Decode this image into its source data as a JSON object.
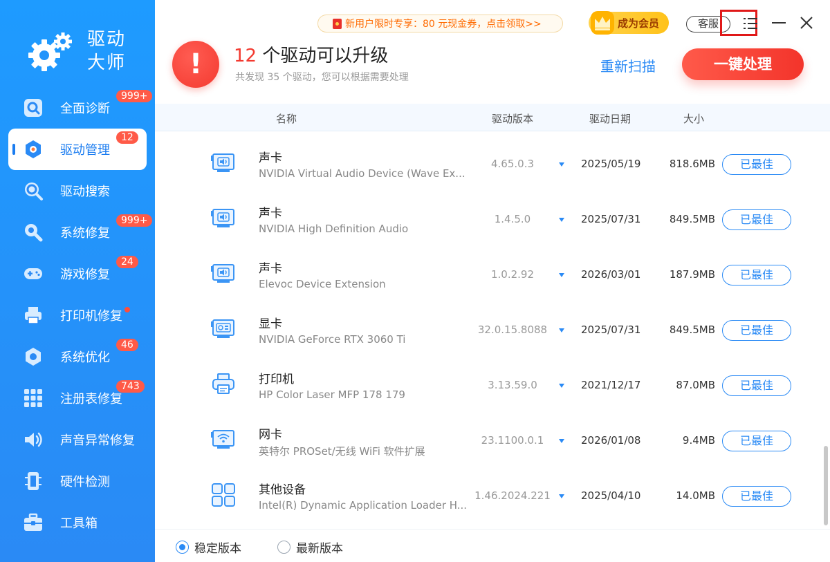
{
  "app": {
    "title_line1": "驱动",
    "title_line2": "大师"
  },
  "sidebar": {
    "items": [
      {
        "label": "全面诊断",
        "icon": "diagnose-icon",
        "badge": "999+"
      },
      {
        "label": "驱动管理",
        "icon": "driver-manage-icon",
        "badge": "12",
        "active": true
      },
      {
        "label": "驱动搜索",
        "icon": "search-icon",
        "badge": ""
      },
      {
        "label": "系统修复",
        "icon": "wrench-icon",
        "badge": "999+"
      },
      {
        "label": "游戏修复",
        "icon": "gamepad-icon",
        "badge": "24"
      },
      {
        "label": "打印机修复",
        "icon": "printer-icon",
        "badge": "",
        "dot": true
      },
      {
        "label": "系统优化",
        "icon": "optimize-icon",
        "badge": "46"
      },
      {
        "label": "注册表修复",
        "icon": "registry-icon",
        "badge": "743"
      },
      {
        "label": "声音异常修复",
        "icon": "speaker-icon",
        "badge": ""
      },
      {
        "label": "硬件检测",
        "icon": "hardware-icon",
        "badge": ""
      },
      {
        "label": "工具箱",
        "icon": "toolbox-icon",
        "badge": ""
      }
    ]
  },
  "topbar": {
    "promo": "新用户限时专享：80 元现金券，点击领取>>",
    "vip": "成为会员",
    "kefu": "客服"
  },
  "summary": {
    "count": "12",
    "headline_rest": " 个驱动可以升级",
    "subline": "共发现 35 个驱动，您可以根据需要处理",
    "rescan": "重新扫描",
    "onekey": "一键处理"
  },
  "table": {
    "headers": {
      "name": "名称",
      "version": "驱动版本",
      "date": "驱动日期",
      "size": "大小"
    },
    "rows": [
      {
        "category": "声卡",
        "name": "NVIDIA Virtual Audio Device (Wave Ex...",
        "version": "4.65.0.3",
        "date": "2025/05/19",
        "size": "818.6MB",
        "status": "已最佳",
        "icon": "sound-card-icon"
      },
      {
        "category": "声卡",
        "name": "NVIDIA High Definition Audio",
        "version": "1.4.5.0",
        "date": "2025/07/31",
        "size": "849.5MB",
        "status": "已最佳",
        "icon": "sound-card-icon"
      },
      {
        "category": "声卡",
        "name": "Elevoc Device Extension",
        "version": "1.0.2.92",
        "date": "2026/03/01",
        "size": "187.9MB",
        "status": "已最佳",
        "icon": "sound-card-icon"
      },
      {
        "category": "显卡",
        "name": "NVIDIA GeForce RTX 3060 Ti",
        "version": "32.0.15.8088",
        "date": "2025/07/31",
        "size": "849.5MB",
        "status": "已最佳",
        "icon": "graphics-card-icon"
      },
      {
        "category": "打印机",
        "name": "HP Color Laser MFP 178 179",
        "version": "3.13.59.0",
        "date": "2021/12/17",
        "size": "87.0MB",
        "status": "已最佳",
        "icon": "printer-icon"
      },
      {
        "category": "网卡",
        "name": "英特尔 PROSet/无线 WiFi 软件扩展",
        "version": "23.1100.0.1",
        "date": "2026/01/08",
        "size": "9.4MB",
        "status": "已最佳",
        "icon": "network-card-icon"
      },
      {
        "category": "其他设备",
        "name": "Intel(R) Dynamic Application Loader H...",
        "version": "1.46.2024.221",
        "date": "2025/04/10",
        "size": "14.0MB",
        "status": "已最佳",
        "icon": "other-device-icon"
      }
    ]
  },
  "footer": {
    "stable": "稳定版本",
    "latest": "最新版本"
  },
  "colors": {
    "brand_blue": "#2a8af5",
    "alert_red": "#f33a30"
  }
}
